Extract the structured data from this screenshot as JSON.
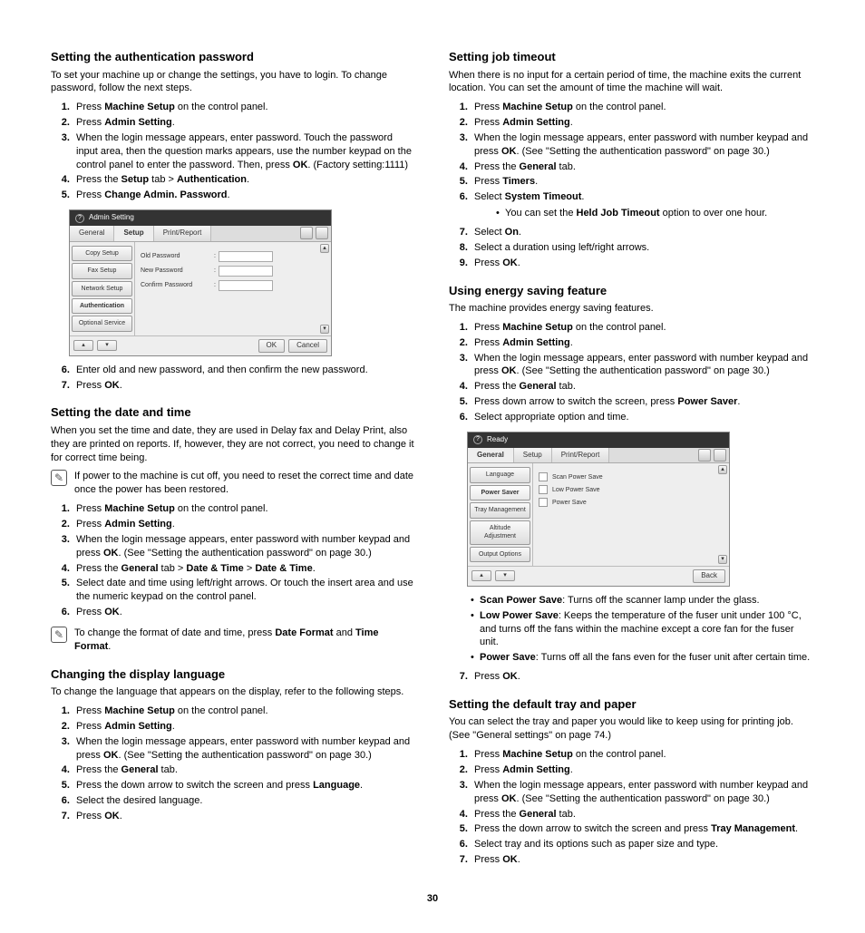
{
  "page_number": "30",
  "left": {
    "s1": {
      "h": "Setting the authentication password",
      "p": "To set your machine up or change the settings, you have to login. To change password, follow the next steps.",
      "steps": [
        "Press <b>Machine Setup</b> on the control panel.",
        "Press <b>Admin Setting</b>.",
        "When the login message appears, enter password. Touch the password input area, then the question marks appears, use the number keypad on the control panel to enter the password. Then, press <b>OK</b>. (Factory setting:1111)",
        "Press the <b>Setup</b> tab > <b>Authentication</b>.",
        "Press <b>Change Admin. Password</b>."
      ],
      "ui": {
        "title": "Admin Setting",
        "tabs": [
          "General",
          "Setup",
          "Print/Report"
        ],
        "active_tab": 1,
        "side": [
          "Copy Setup",
          "Fax Setup",
          "Network Setup",
          "Authentication",
          "Optional Service"
        ],
        "side_sel": 3,
        "rows": [
          {
            "lbl": "Old Password",
            "col": ":"
          },
          {
            "lbl": "New Password",
            "col": ":"
          },
          {
            "lbl": "Confirm Password",
            "col": ":"
          }
        ],
        "footer": {
          "ok": "OK",
          "cancel": "Cancel"
        }
      },
      "steps2": [
        "Enter old and new password, and then confirm the new password.",
        "Press <b>OK</b>."
      ]
    },
    "s2": {
      "h": "Setting the date and time",
      "p": "When you set the time and date, they are used in Delay fax and Delay Print, also they are printed on reports. If, however, they are not correct, you need to change it for correct time being.",
      "note": "If power to the machine is cut off, you need to reset the correct time and date once the power has been restored.",
      "steps": [
        "Press <b>Machine Setup</b> on the control panel.",
        "Press <b>Admin Setting</b>.",
        "When the login message appears, enter password with number keypad and press <b>OK</b>. (See \"Setting the authentication password\" on page 30.)",
        "Press the <b>General</b> tab > <b>Date & Time</b> > <b>Date & Time</b>.",
        "Select date and time using left/right arrows. Or touch the insert area and use the numeric keypad on the control panel.",
        "Press <b>OK</b>."
      ],
      "note2": "To change the format of date and time, press <b>Date Format</b> and <b>Time Format</b>."
    },
    "s3": {
      "h": "Changing the display language",
      "p": "To change the language that appears on the display, refer to the following steps.",
      "steps": [
        "Press <b>Machine Setup</b> on the control panel.",
        "Press <b>Admin Setting</b>.",
        "When the login message appears, enter password with number keypad and press <b>OK</b>. (See \"Setting the authentication password\" on page 30.)",
        "Press the <b>General</b> tab.",
        "Press the down arrow to switch the screen and press <b>Language</b>.",
        "Select the desired language.",
        "Press <b>OK</b>."
      ]
    }
  },
  "right": {
    "s1": {
      "h": "Setting job timeout",
      "p": "When there is no input for a certain period of time, the machine exits the current location. You can set the amount of time the machine will wait.",
      "steps": [
        "Press <b>Machine Setup</b> on the control panel.",
        "Press <b>Admin Setting</b>.",
        "When the login message appears, enter password with number keypad and press <b>OK</b>. (See \"Setting the authentication password\" on page 30.)",
        "Press the <b>General</b> tab.",
        "Press <b>Timers</b>.",
        "Select <b>System Timeout</b>.",
        "Select <b>On</b>.",
        "Select a duration using left/right arrows.",
        "Press <b>OK</b>."
      ],
      "sub6": "You can set the <b>Held Job Timeout</b> option to over one hour."
    },
    "s2": {
      "h": "Using energy saving feature",
      "p": "The machine provides energy saving features.",
      "steps": [
        "Press <b>Machine Setup</b> on the control panel.",
        "Press <b>Admin Setting</b>.",
        "When the login message appears, enter password with number keypad and press <b>OK</b>. (See \"Setting the authentication password\" on page 30.)",
        "Press the <b>General</b> tab.",
        "Press down arrow to switch the screen, press <b>Power Saver</b>.",
        "Select appropriate option and time."
      ],
      "ui": {
        "title": "Ready",
        "tabs": [
          "General",
          "Setup",
          "Print/Report"
        ],
        "active_tab": 0,
        "side": [
          "Language",
          "Power Saver",
          "Tray Management",
          "Altitude Adjustment",
          "Output Options"
        ],
        "side_sel": 1,
        "opts": [
          "Scan Power Save",
          "Low Power Save",
          "Power Save"
        ],
        "footer": {
          "back": "Back"
        }
      },
      "bullets": [
        "<b>Scan Power Save</b>: Turns off the scanner lamp under the glass.",
        "<b>Low Power Save</b>: Keeps the temperature of the fuser unit under 100 °C, and turns off the fans within the machine except a core fan for the fuser unit.",
        "<b>Power Save</b>: Turns off all the fans even for the fuser unit after certain time."
      ],
      "steps2": [
        "Press <b>OK</b>."
      ]
    },
    "s3": {
      "h": "Setting the default tray and paper",
      "p": "You can select the tray and paper you would like to keep using for printing job. (See \"General settings\" on page 74.)",
      "steps": [
        "Press <b>Machine Setup</b> on the control panel.",
        "Press <b>Admin Setting</b>.",
        "When the login message appears, enter password with number keypad and press <b>OK</b>. (See \"Setting the authentication password\" on page 30.)",
        "Press the <b>General</b> tab.",
        "Press the down arrow to switch the screen and press <b>Tray Management</b>.",
        "Select tray and its options such as paper size and type.",
        "Press <b>OK</b>."
      ]
    }
  }
}
